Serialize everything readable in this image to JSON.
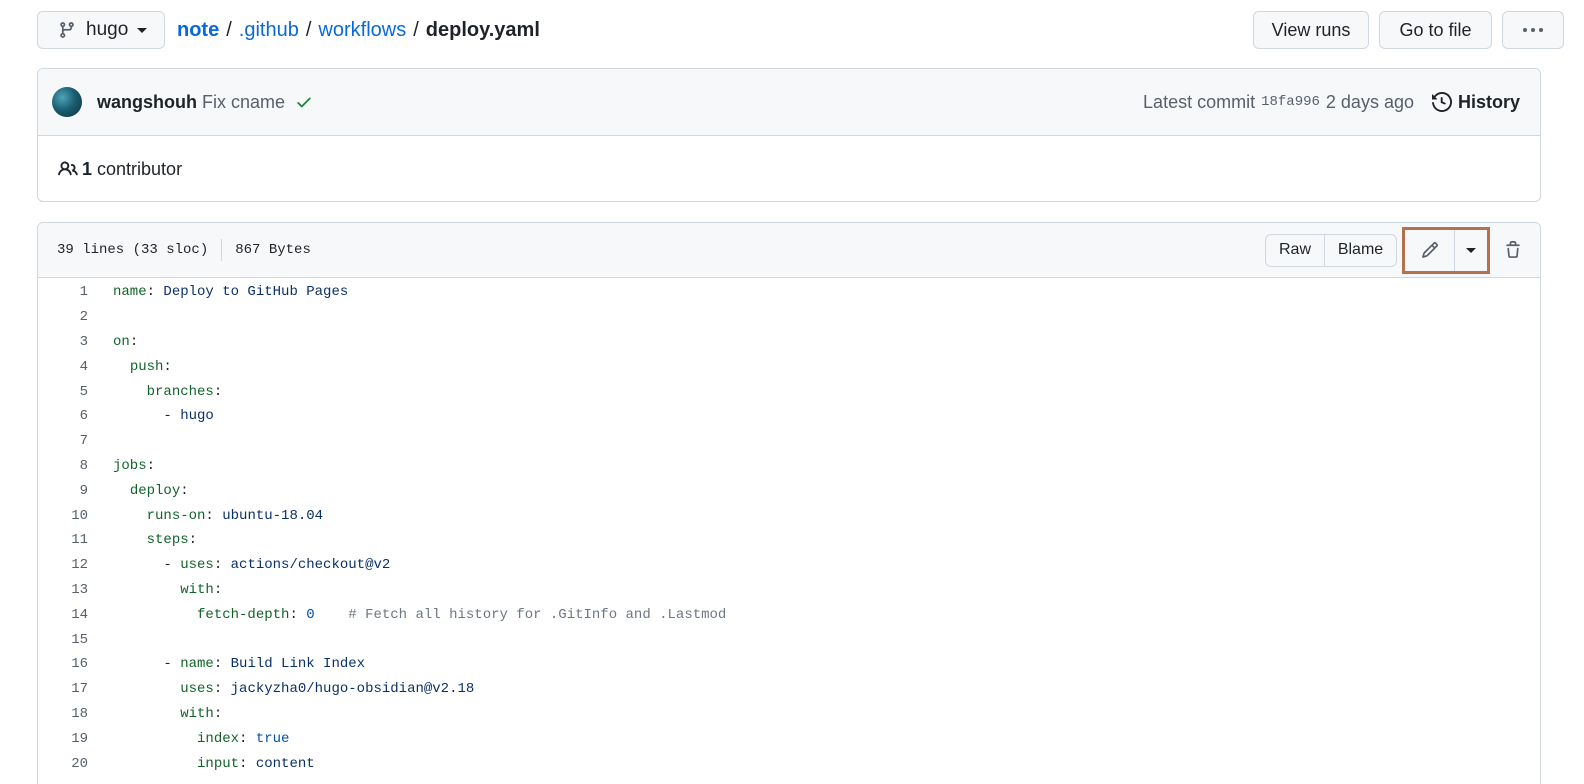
{
  "branch": {
    "name": "hugo"
  },
  "breadcrumb": {
    "repo": "note",
    "dir1": ".github",
    "dir2": "workflows",
    "file": "deploy.yaml",
    "sep": "/"
  },
  "top_actions": {
    "view_runs": "View runs",
    "go_to_file": "Go to file",
    "more": "···"
  },
  "commit": {
    "author": "wangshouh",
    "message": "Fix cname",
    "latest_label": "Latest commit",
    "sha": "18fa996",
    "time": "2 days ago",
    "history_label": "History"
  },
  "contributors": {
    "count": "1",
    "label": "contributor"
  },
  "file": {
    "lines_info": "39 lines (33 sloc)",
    "size": "867 Bytes",
    "raw_label": "Raw",
    "blame_label": "Blame"
  },
  "code": [
    {
      "n": "1",
      "indent": "",
      "key": "name",
      "value": "Deploy to GitHub Pages",
      "vtype": "s",
      "comment": ""
    },
    {
      "n": "2",
      "indent": "",
      "key": "",
      "value": "",
      "vtype": "",
      "comment": ""
    },
    {
      "n": "3",
      "indent": "",
      "key": "on",
      "value": "",
      "vtype": "",
      "comment": ""
    },
    {
      "n": "4",
      "indent": "  ",
      "key": "push",
      "value": "",
      "vtype": "",
      "comment": ""
    },
    {
      "n": "5",
      "indent": "    ",
      "key": "branches",
      "value": "",
      "vtype": "",
      "comment": ""
    },
    {
      "n": "6",
      "indent": "      - ",
      "key": "",
      "value": "hugo",
      "vtype": "s",
      "comment": ""
    },
    {
      "n": "7",
      "indent": "",
      "key": "",
      "value": "",
      "vtype": "",
      "comment": ""
    },
    {
      "n": "8",
      "indent": "",
      "key": "jobs",
      "value": "",
      "vtype": "",
      "comment": ""
    },
    {
      "n": "9",
      "indent": "  ",
      "key": "deploy",
      "value": "",
      "vtype": "",
      "comment": ""
    },
    {
      "n": "10",
      "indent": "    ",
      "key": "runs-on",
      "value": "ubuntu-18.04",
      "vtype": "s",
      "comment": ""
    },
    {
      "n": "11",
      "indent": "    ",
      "key": "steps",
      "value": "",
      "vtype": "",
      "comment": ""
    },
    {
      "n": "12",
      "indent": "      - ",
      "key": "uses",
      "value": "actions/checkout@v2",
      "vtype": "s",
      "comment": ""
    },
    {
      "n": "13",
      "indent": "        ",
      "key": "with",
      "value": "",
      "vtype": "",
      "comment": ""
    },
    {
      "n": "14",
      "indent": "          ",
      "key": "fetch-depth",
      "value": "0",
      "vtype": "n",
      "comment": "# Fetch all history for .GitInfo and .Lastmod"
    },
    {
      "n": "15",
      "indent": "",
      "key": "",
      "value": "",
      "vtype": "",
      "comment": ""
    },
    {
      "n": "16",
      "indent": "      - ",
      "key": "name",
      "value": "Build Link Index",
      "vtype": "s",
      "comment": ""
    },
    {
      "n": "17",
      "indent": "        ",
      "key": "uses",
      "value": "jackyzha0/hugo-obsidian@v2.18",
      "vtype": "s",
      "comment": ""
    },
    {
      "n": "18",
      "indent": "        ",
      "key": "with",
      "value": "",
      "vtype": "",
      "comment": ""
    },
    {
      "n": "19",
      "indent": "          ",
      "key": "index",
      "value": "true",
      "vtype": "n",
      "comment": ""
    },
    {
      "n": "20",
      "indent": "          ",
      "key": "input",
      "value": "content",
      "vtype": "s",
      "comment": ""
    }
  ]
}
